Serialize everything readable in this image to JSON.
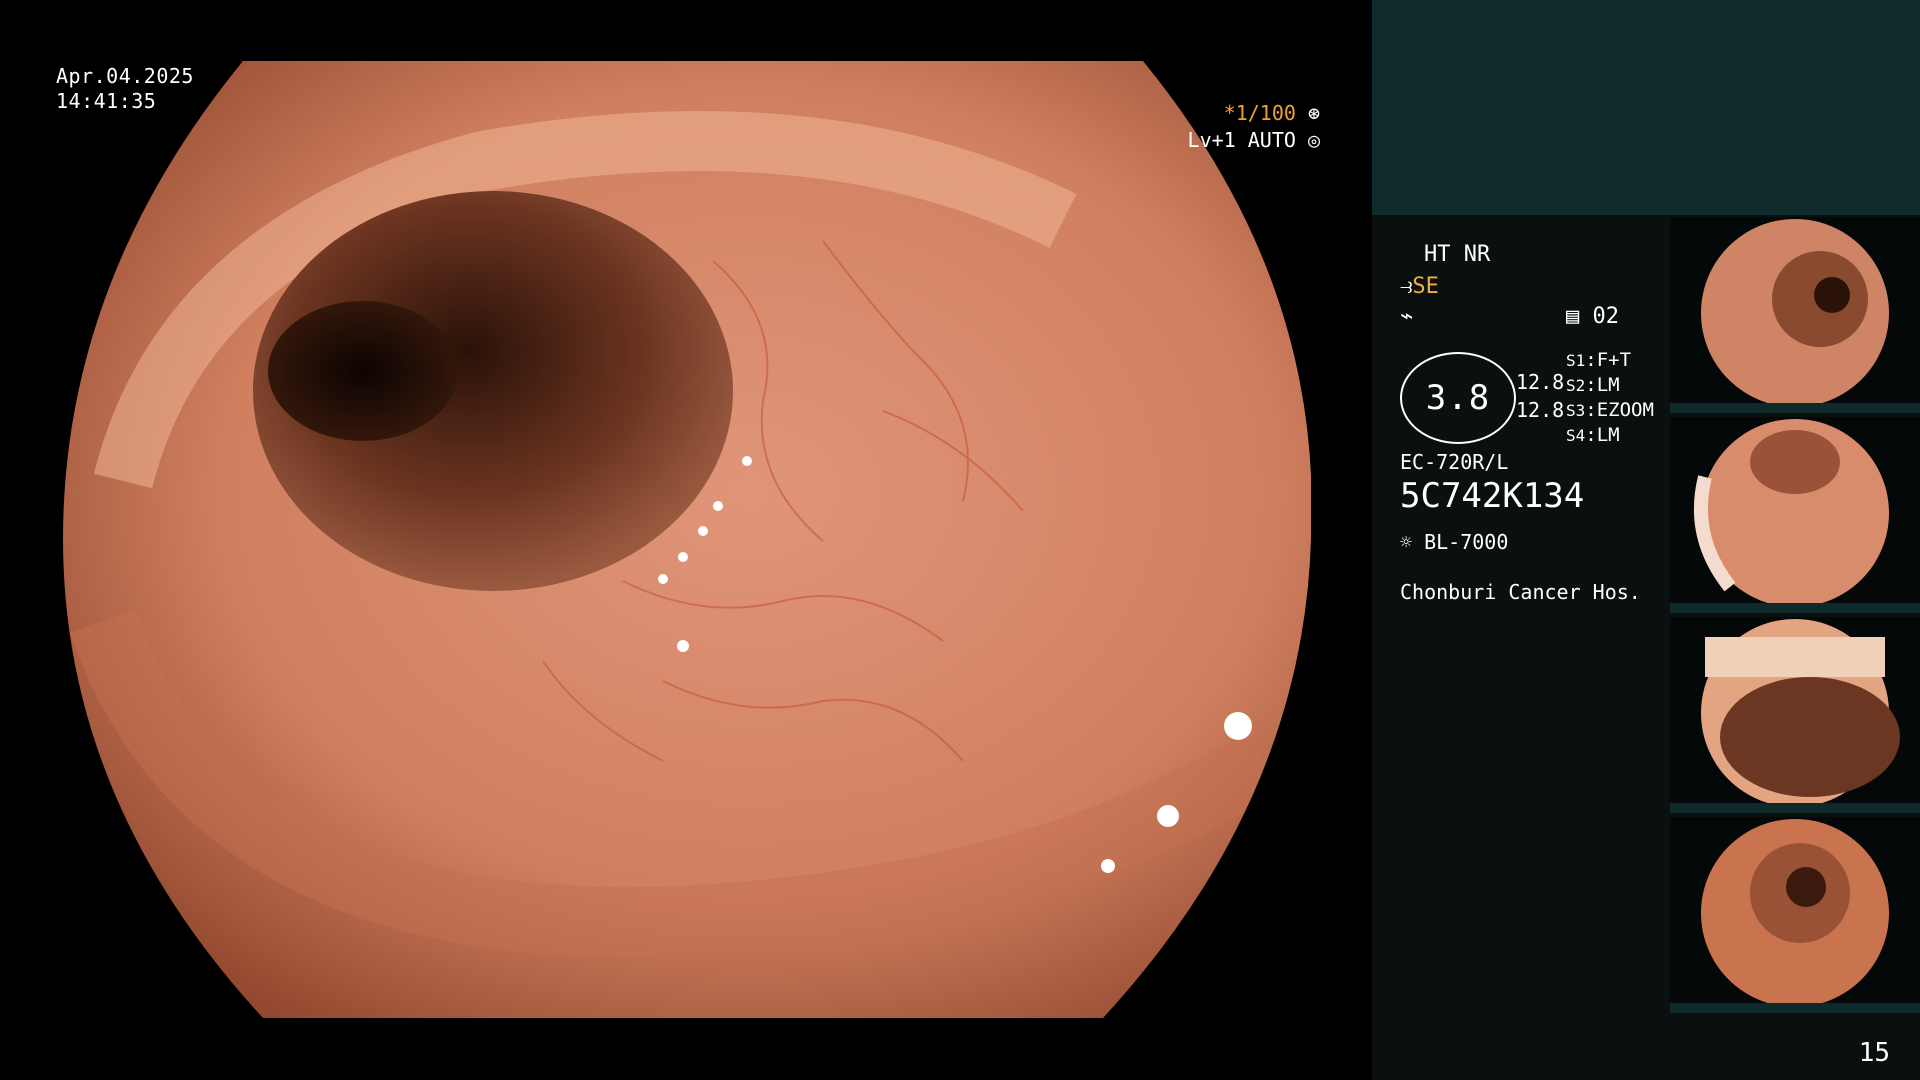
{
  "main": {
    "date": "Apr.04.2025",
    "time": "14:41:35",
    "shutter_speed": "*1/100",
    "level": "Lv+1 AUTO"
  },
  "info": {
    "ht_nr": "HT NR",
    "se_label": "SE",
    "program": "02",
    "value": "3.8",
    "value_a": "12.8",
    "value_b": "12.8",
    "switches": [
      {
        "key": "S1",
        "value": "F+T"
      },
      {
        "key": "S2",
        "value": "LM"
      },
      {
        "key": "S3",
        "value": "EZOOM"
      },
      {
        "key": "S4",
        "value": "LM"
      }
    ],
    "scope_model": "EC-720R/L",
    "serial": "5C742K134",
    "light_source": "BL-7000",
    "hospital": "Chonburi Cancer Hos."
  },
  "page_number": "15",
  "colors": {
    "background": "#000000",
    "panel": "#0a0f0f",
    "panel_band": "#0e2a2a",
    "accent_yellow": "#f0b030",
    "tissue": "#d98a6a"
  },
  "icons": {
    "shutter": "aperture-icon",
    "auto": "iris-icon",
    "scope": "scope-tip-icon",
    "freeze": "lightning-icon",
    "program": "memory-icon",
    "light": "sun-icon"
  }
}
